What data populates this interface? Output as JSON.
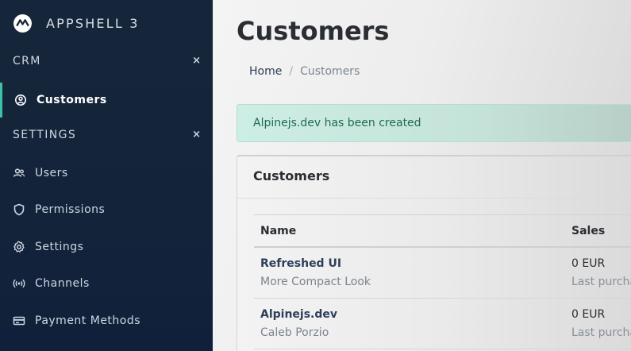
{
  "app": {
    "name": "APPSHELL 3"
  },
  "sidebar": {
    "sections": [
      {
        "label": "CRM",
        "toggle": "×",
        "items": [
          {
            "label": "Customers",
            "icon": "customers-icon",
            "active": true
          }
        ]
      },
      {
        "label": "SETTINGS",
        "toggle": "×",
        "items": [
          {
            "label": "Users",
            "icon": "users-icon"
          },
          {
            "label": "Permissions",
            "icon": "shield-icon"
          },
          {
            "label": "Settings",
            "icon": "gear-icon"
          },
          {
            "label": "Channels",
            "icon": "broadcast-icon"
          },
          {
            "label": "Payment Methods",
            "icon": "credit-card-icon"
          }
        ]
      }
    ]
  },
  "page": {
    "title": "Customers",
    "breadcrumb": {
      "home": "Home",
      "separator": "/",
      "current": "Customers"
    }
  },
  "alert": {
    "text": "Alpinejs.dev has been created"
  },
  "card": {
    "title": "Customers",
    "columns": {
      "name": "Name",
      "sales": "Sales"
    },
    "rows": [
      {
        "name": "Refreshed UI",
        "sub": "More Compact Look",
        "sales": "0 EUR",
        "sales_sub": "Last purchas"
      },
      {
        "name": "Alpinejs.dev",
        "sub": "Caleb Porzio",
        "sales": "0 EUR",
        "sales_sub": "Last purchas"
      }
    ]
  },
  "colors": {
    "sidebar_bg": "#13243a",
    "accent": "#3fc1a7",
    "alert_bg": "#cdeee5",
    "alert_text": "#1f6a4f"
  }
}
